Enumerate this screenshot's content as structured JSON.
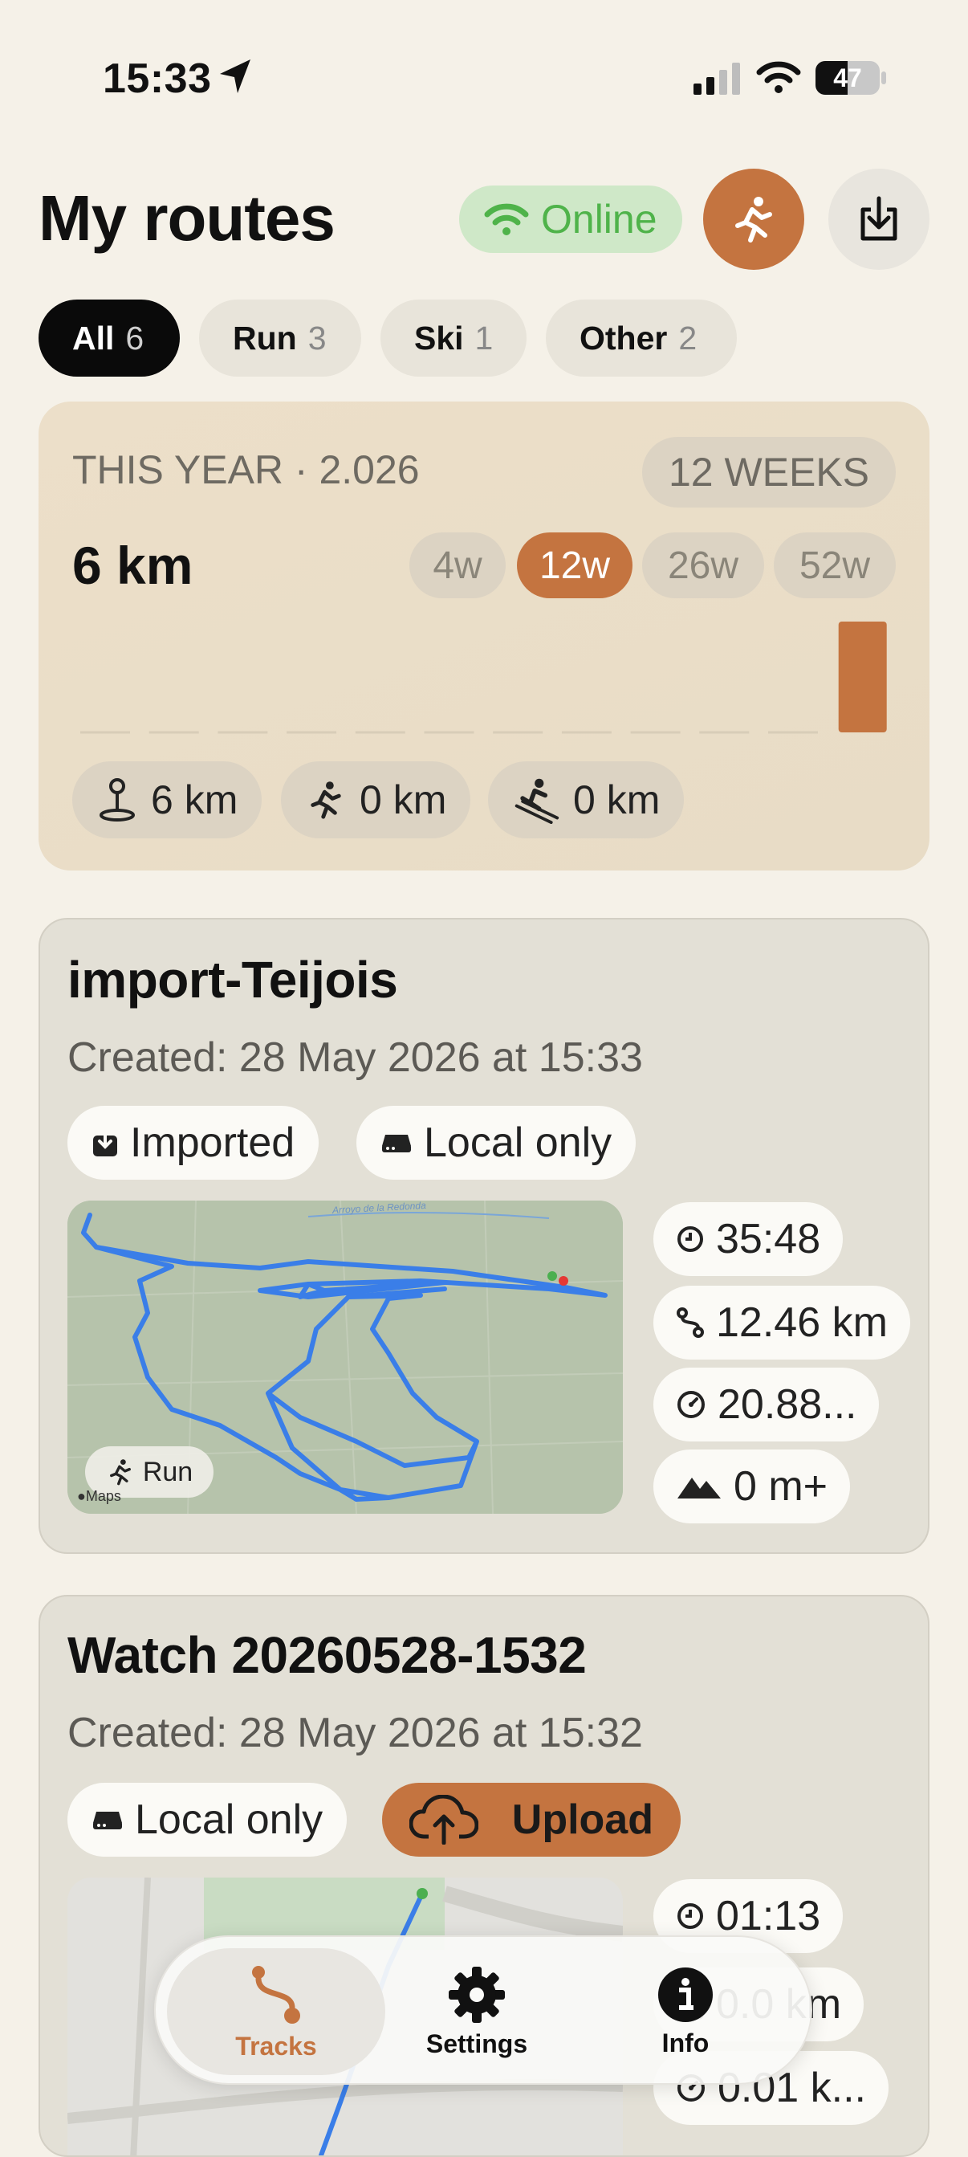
{
  "status_bar": {
    "time": "15:33",
    "battery": "47"
  },
  "header": {
    "title": "My routes",
    "online_label": "Online"
  },
  "filters": [
    {
      "label": "All",
      "count": "6"
    },
    {
      "label": "Run",
      "count": "3"
    },
    {
      "label": "Ski",
      "count": "1"
    },
    {
      "label": "Other",
      "count": "2"
    }
  ],
  "summary": {
    "period_label": "THIS YEAR · 2.026",
    "weeks_badge": "12 WEEKS",
    "total": "6 km",
    "ranges": [
      "4w",
      "12w",
      "26w",
      "52w"
    ],
    "active_range": "12w",
    "weekly_km": [
      0,
      0,
      0,
      0,
      0,
      0,
      0,
      0,
      0,
      0,
      0,
      6
    ],
    "stats": [
      {
        "icon": "pin-icon",
        "value": "6 km"
      },
      {
        "icon": "run-icon",
        "value": "0 km"
      },
      {
        "icon": "ski-icon",
        "value": "0 km"
      }
    ]
  },
  "routes": [
    {
      "title": "import-Teijois",
      "created": "Created: 28 May 2026 at 15:33",
      "tags": [
        "Imported",
        "Local only"
      ],
      "activity": "Run",
      "map_credit": "Maps",
      "map_road_label": "Arroyo de la Redonda",
      "metrics": {
        "duration": "35:48",
        "distance": "12.46 km",
        "pace": "20.88...",
        "elevation": "0 m+"
      }
    },
    {
      "title": "Watch 20260528-1532",
      "created": "Created: 28 May 2026 at 15:32",
      "tags": [
        "Local only"
      ],
      "upload_label": "Upload",
      "metrics": {
        "duration": "01:13",
        "distance": "0.0 km",
        "pace": "0.01 k..."
      }
    }
  ],
  "tabbar": {
    "tracks": "Tracks",
    "settings": "Settings",
    "info": "Info"
  },
  "colors": {
    "accent": "#c47440",
    "background": "#f5f1e8",
    "online_green": "#4fb34a",
    "track_blue": "#3a7ee8"
  }
}
